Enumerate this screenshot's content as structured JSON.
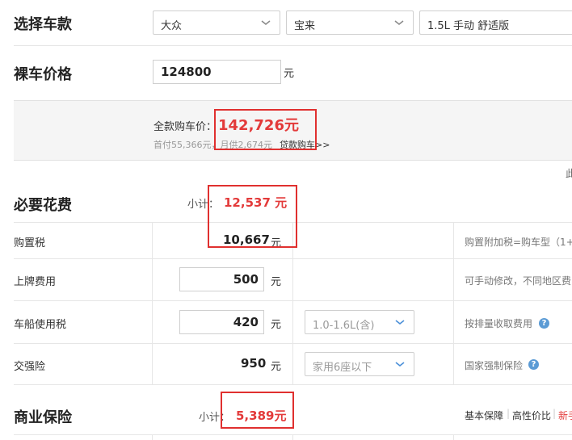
{
  "select_car": {
    "title": "选择车款",
    "brand": "大众",
    "model": "宝来",
    "trim": "1.5L 手动 舒适版"
  },
  "bare_price": {
    "title": "裸车价格",
    "value": "124800",
    "unit": "元"
  },
  "summary": {
    "full_label": "全款购车价：",
    "full_value": "142,726元",
    "sub_text": "首付55,366元，月供2,674元",
    "loan_link": "贷款购车>>",
    "edge_text": "此"
  },
  "necessary": {
    "title": "必要花费",
    "subtotal_label": "小计：",
    "subtotal_value": "12,537 元",
    "rows": [
      {
        "label": "购置税",
        "value": "10,667",
        "unit": "元",
        "note": "购置附加税=购车型（1+"
      },
      {
        "label": "上牌费用",
        "value": "500",
        "unit": "元",
        "note": "可手动修改，不同地区费"
      },
      {
        "label": "车船使用税",
        "value": "420",
        "unit": "元",
        "select": "1.0-1.6L(含)",
        "note": "按排量收取费用"
      },
      {
        "label": "交强险",
        "value": "950",
        "unit": "元",
        "select": "家用6座以下",
        "note": "国家强制保险"
      }
    ]
  },
  "commercial": {
    "title": "商业保险",
    "subtotal_label": "小计：",
    "subtotal_value": "5,389元",
    "tabs": [
      "基本保障",
      "高性价比",
      "新手"
    ]
  },
  "colors": {
    "accent_red": "#e33a3a",
    "highlight_box": "#e0302f",
    "help_icon": "#5b9bd5"
  }
}
